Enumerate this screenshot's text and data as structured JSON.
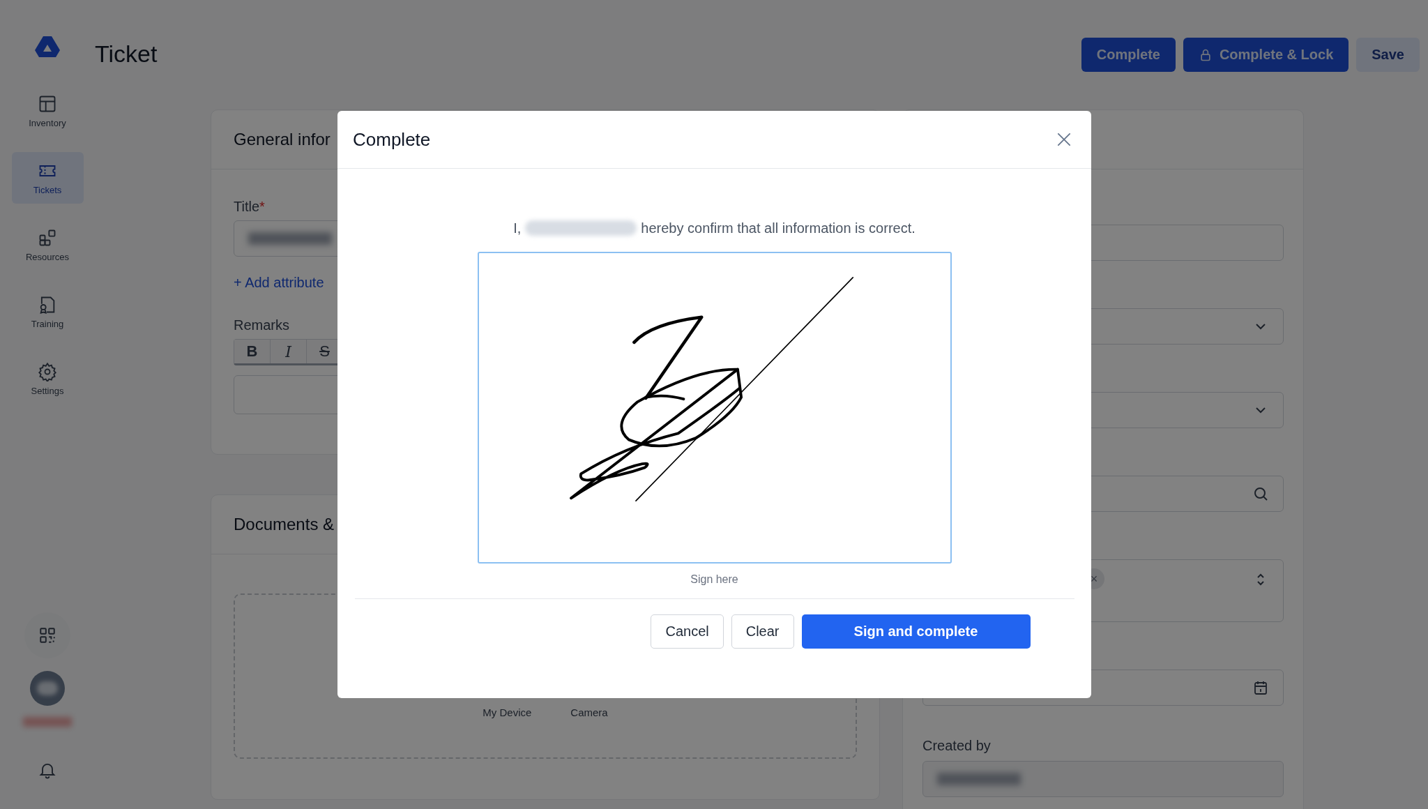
{
  "sidebar": {
    "items": [
      {
        "label": "Inventory",
        "selected": false
      },
      {
        "label": "Tickets",
        "selected": true
      },
      {
        "label": "Resources",
        "selected": false
      },
      {
        "label": "Training",
        "selected": false
      },
      {
        "label": "Settings",
        "selected": false
      }
    ]
  },
  "header": {
    "title": "Ticket",
    "actions": [
      {
        "label": "Complete",
        "kind": "primary"
      },
      {
        "label": "Complete & Lock",
        "kind": "lock"
      },
      {
        "label": "Save",
        "kind": "secondary"
      }
    ]
  },
  "general_card": {
    "title": "General infor",
    "title_label": "Title",
    "required_mark": "*",
    "add_attribute": "+ Add attribute",
    "remarks_label": "Remarks",
    "toolbar": [
      {
        "label": "B",
        "kind": "bold"
      },
      {
        "label": "I",
        "kind": "italic"
      },
      {
        "label": "S",
        "kind": "strike"
      }
    ]
  },
  "documents_card": {
    "title": "Documents &",
    "sources": [
      "My Device",
      "Camera"
    ]
  },
  "details_card": {
    "fields": [
      {
        "kind": "text"
      },
      {
        "kind": "select"
      },
      {
        "kind": "select"
      },
      {
        "kind": "search"
      },
      {
        "kind": "multiselect",
        "chip_remove": "×"
      },
      {
        "kind": "date"
      }
    ],
    "created_by_label": "Created by"
  },
  "dialog": {
    "title": "Complete",
    "statement_prefix": "I,",
    "statement_suffix": "hereby confirm that all information is correct.",
    "pad_hint": "Sign here",
    "buttons": [
      {
        "label": "Cancel",
        "kind": "outline"
      },
      {
        "label": "Clear",
        "kind": "outline"
      },
      {
        "label": "Sign and complete",
        "kind": "primary"
      }
    ]
  }
}
